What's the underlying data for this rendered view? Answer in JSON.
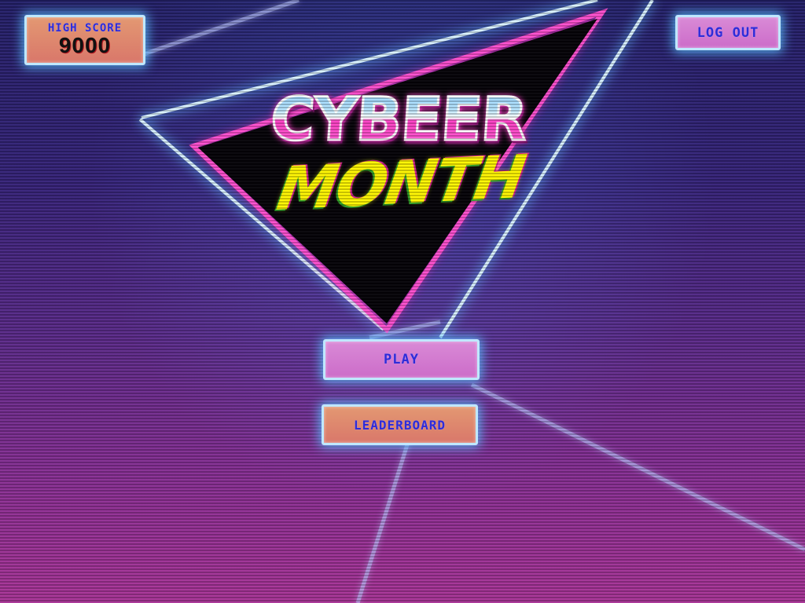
{
  "game": {
    "logo": {
      "line1": "CYBEER",
      "line2": "MONTH"
    }
  },
  "hud": {
    "high_score_label": "HIGH SCORE",
    "high_score_value": "9000"
  },
  "menu": {
    "logout_label": "LOG OUT",
    "play_label": "PLAY",
    "leaderboard_label": "LEADERBOARD"
  },
  "colors": {
    "neon_blue": "#8fd6ff",
    "neon_pink": "#ff3fc6",
    "logo_yellow": "#fff600",
    "button_orange": "#e0876d",
    "button_pink": "#d47bd0",
    "label_blue": "#2f2bd8"
  }
}
